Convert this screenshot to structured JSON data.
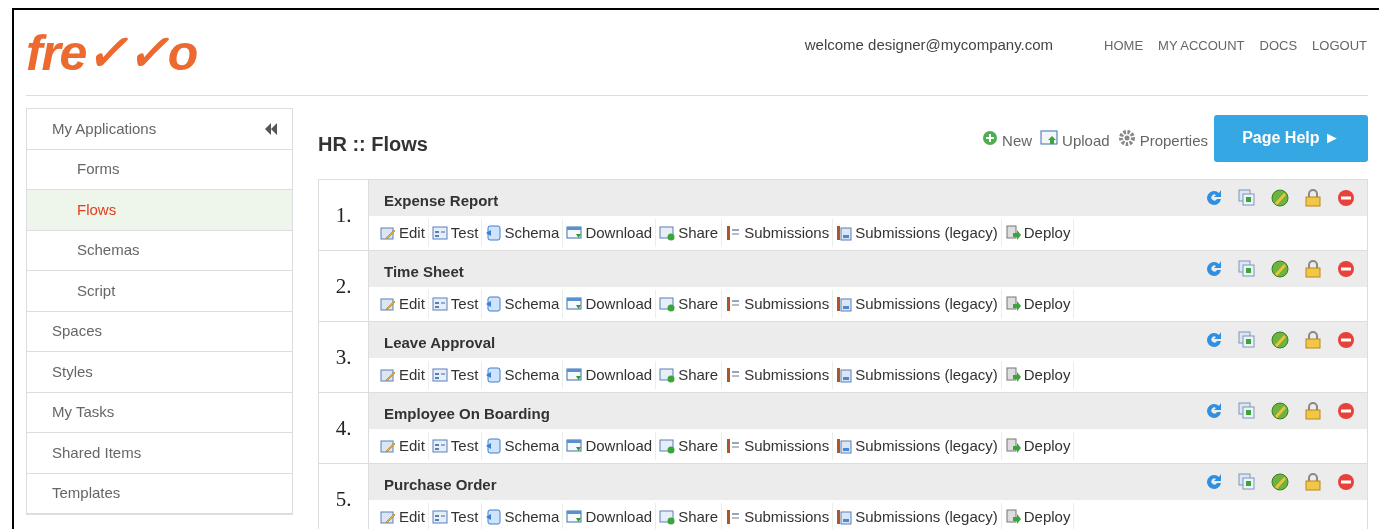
{
  "header": {
    "logo": "fre✓✓o",
    "welcome": "welcome designer@mycompany.com",
    "nav": [
      "HOME",
      "MY ACCOUNT",
      "DOCS",
      "LOGOUT"
    ]
  },
  "sidebar": {
    "items": [
      {
        "label": "My Applications",
        "selected": false,
        "children": [
          {
            "label": "Forms",
            "selected": false
          },
          {
            "label": "Flows",
            "selected": true
          },
          {
            "label": "Schemas",
            "selected": false
          },
          {
            "label": "Script",
            "selected": false
          }
        ]
      },
      {
        "label": "Spaces",
        "selected": false
      },
      {
        "label": "Styles",
        "selected": false
      },
      {
        "label": "My Tasks",
        "selected": false
      },
      {
        "label": "Shared Items",
        "selected": false
      },
      {
        "label": "Templates",
        "selected": false
      }
    ]
  },
  "main": {
    "title": "HR :: Flows",
    "toolbar": [
      "New",
      "Upload",
      "Properties"
    ],
    "help_button": "Page Help ►"
  },
  "flows": [
    {
      "number": "1.",
      "name": "Expense Report",
      "actions": [
        "Edit",
        "Test",
        "Schema",
        "Download",
        "Share",
        "Submissions",
        "Submissions (legacy)",
        "Deploy"
      ]
    },
    {
      "number": "2.",
      "name": "Time Sheet",
      "actions": [
        "Edit",
        "Test",
        "Schema",
        "Download",
        "Share",
        "Submissions",
        "Submissions (legacy)",
        "Deploy"
      ]
    },
    {
      "number": "3.",
      "name": "Leave Approval",
      "actions": [
        "Edit",
        "Test",
        "Schema",
        "Download",
        "Share",
        "Submissions",
        "Submissions (legacy)",
        "Deploy"
      ]
    },
    {
      "number": "4.",
      "name": "Employee On Boarding",
      "actions": [
        "Edit",
        "Test",
        "Schema",
        "Download",
        "Share",
        "Submissions",
        "Submissions (legacy)",
        "Deploy"
      ]
    },
    {
      "number": "5.",
      "name": "Purchase Order",
      "actions": [
        "Edit",
        "Test",
        "Schema",
        "Download",
        "Share",
        "Submissions",
        "Submissions (legacy)",
        "Deploy"
      ]
    }
  ]
}
